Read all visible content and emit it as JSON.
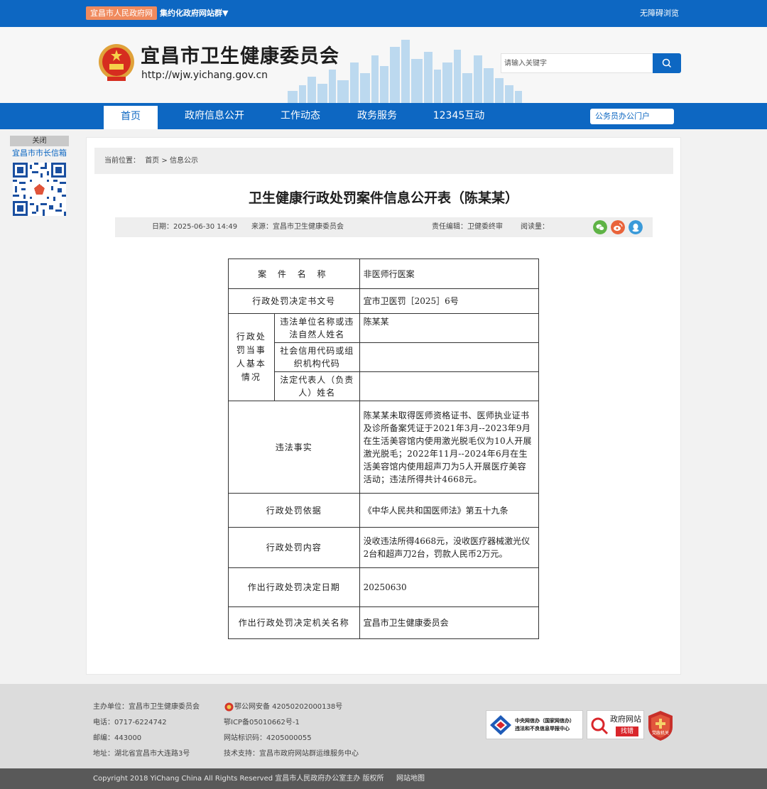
{
  "topbar": {
    "gov_link": "宜昌市人民政府网",
    "site_group": "集约化政府网站群▼",
    "accessible": "无障碍浏览"
  },
  "header": {
    "title": "宜昌市卫生健康委员会",
    "url": "http://wjw.yichang.gov.cn",
    "search_placeholder": "请输入关键字"
  },
  "nav": {
    "items": [
      "首页",
      "政府信息公开",
      "工作动态",
      "政务服务",
      "12345互动"
    ],
    "portal": "公务员办公门户"
  },
  "float": {
    "close": "关闭",
    "label": "宜昌市市长信箱"
  },
  "breadcrumb": {
    "prefix": "当前位置：",
    "home": "首页",
    "sep": ">",
    "current": "信息公示"
  },
  "article": {
    "title": "卫生健康行政处罚案件信息公开表（陈某某）",
    "date": "日期：2025-06-30 14:49",
    "source": "来源：宜昌市卫生健康委员会",
    "editor": "责任编辑：卫健委终审",
    "views": "阅读量："
  },
  "table": {
    "case_name_label": "案 件 名 称",
    "case_name": "非医师行医案",
    "doc_no_label": "行政处罚决定书文号",
    "doc_no": "宜市卫医罚［2025］6号",
    "party_label": "行政处罚当事人基本情况",
    "party_name_label": "违法单位名称或违法自然人姓名",
    "party_name": "陈某某",
    "credit_code_label": "社会信用代码或组织机构代码",
    "credit_code": "",
    "legal_rep_label": "法定代表人（负责人）姓名",
    "legal_rep": "",
    "facts_label": "违法事实",
    "facts": "陈某某未取得医师资格证书、医师执业证书及诊所备案凭证于2021年3月--2023年9月在生活美容馆内使用激光脱毛仪为10人开展激光脱毛；2022年11月--2024年6月在生活美容馆内使用超声刀为5人开展医疗美容活动；违法所得共计4668元。",
    "basis_label": "行政处罚依据",
    "basis": "《中华人民共和国医师法》第五十九条",
    "content_label": "行政处罚内容",
    "content": "没收违法所得4668元，没收医疗器械激光仪2台和超声刀2台，罚款人民币2万元。",
    "date_label": "作出行政处罚决定日期",
    "date": "20250630",
    "org_label": "作出行政处罚决定机关名称",
    "org": "宜昌市卫生健康委员会"
  },
  "footer": {
    "host": "主办单位：宜昌市卫生健康委员会",
    "phone": "电话：0717-6224742",
    "postcode": "邮编：443000",
    "address": "地址：湖北省宜昌市大连路3号",
    "police": "鄂公网安备 42050202000138号",
    "icp": "鄂ICP备05010662号-1",
    "site_id": "网站标识码：4205000055",
    "support": "技术支持：宜昌市政府网站群运维服务中心",
    "badge1_line1": "中央网信办（国家网信办）",
    "badge1_line2": "违法和不良信息举报中心",
    "badge2_line1": "政府网站",
    "badge2_line2": "找错",
    "badge3": "党政机关",
    "copyright": "Copyright 2018 YiChang China All Rights Reserved 宜昌市人民政府办公室主办 版权所",
    "sitemap": "网站地图"
  },
  "colors": {
    "primary_blue": "#0d67c2",
    "gov_link_orange": "#f08a5d",
    "footer_gray": "#dcdcdc",
    "copyright_gray": "#595959"
  }
}
